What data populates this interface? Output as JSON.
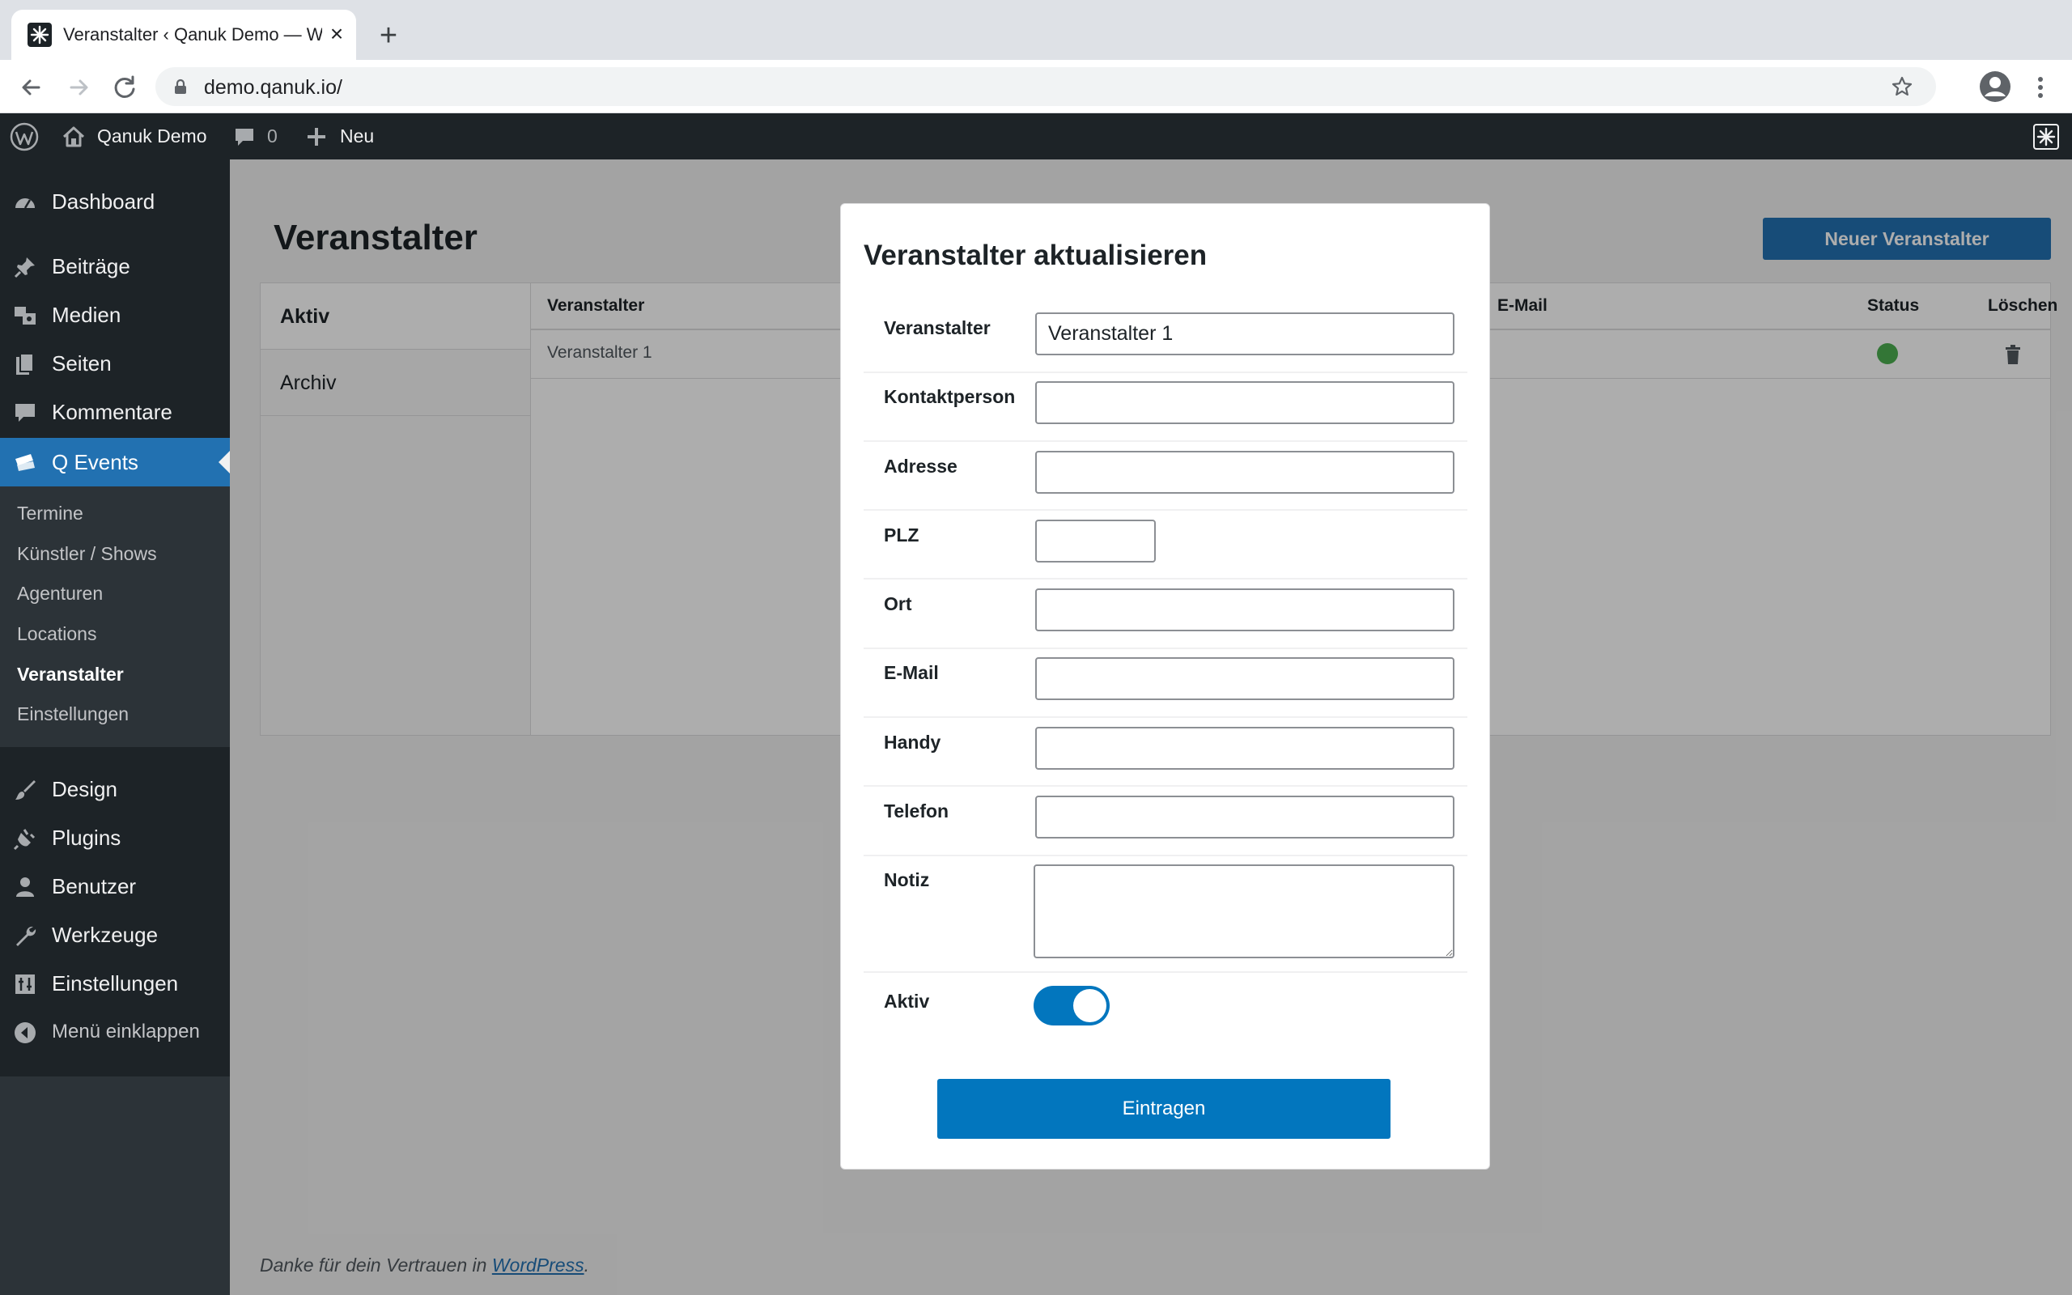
{
  "browser": {
    "tab_title": "Veranstalter ‹ Qanuk Demo — WordPress",
    "url": "demo.qanuk.io/",
    "icons": [
      "back-icon",
      "forward-icon",
      "reload-icon",
      "lock-icon",
      "star-icon",
      "profile-icon",
      "menu-icon"
    ]
  },
  "adminbar": {
    "site_name": "Qanuk Demo",
    "comments_count": "0",
    "new_label": "Neu"
  },
  "sidebar": {
    "items": [
      {
        "label": "Dashboard",
        "icon": "dashboard-icon"
      },
      {
        "label": "Beiträge",
        "icon": "pin-icon"
      },
      {
        "label": "Medien",
        "icon": "media-icon"
      },
      {
        "label": "Seiten",
        "icon": "pages-icon"
      },
      {
        "label": "Kommentare",
        "icon": "comment-icon"
      },
      {
        "label": "Q Events",
        "icon": "tickets-icon"
      }
    ],
    "submenu": [
      "Termine",
      "Künstler / Shows",
      "Agenturen",
      "Locations",
      "Veranstalter",
      "Einstellungen"
    ],
    "items_bottom": [
      {
        "label": "Design",
        "icon": "brush-icon"
      },
      {
        "label": "Plugins",
        "icon": "plugin-icon"
      },
      {
        "label": "Benutzer",
        "icon": "user-icon"
      },
      {
        "label": "Werkzeuge",
        "icon": "wrench-icon"
      },
      {
        "label": "Einstellungen",
        "icon": "settings-icon"
      }
    ],
    "collapse_label": "Menü einklappen"
  },
  "main": {
    "page_title": "Veranstalter",
    "new_button": "Neuer Veranstalter",
    "tabs": [
      "Aktiv",
      "Archiv"
    ],
    "columns": [
      "Veranstalter",
      "E-Mail",
      "Status",
      "Löschen"
    ],
    "rows": [
      {
        "name": "Veranstalter 1",
        "email": "",
        "status": "active"
      }
    ],
    "footer_prefix": "Danke für dein Vertrauen in ",
    "footer_link": "WordPress",
    "footer_suffix": "."
  },
  "modal": {
    "title": "Veranstalter aktualisieren",
    "fields": [
      {
        "label": "Veranstalter",
        "value": "Veranstalter 1"
      },
      {
        "label": "Kontaktperson",
        "value": ""
      },
      {
        "label": "Adresse",
        "value": ""
      },
      {
        "label": "PLZ",
        "value": ""
      },
      {
        "label": "Ort",
        "value": ""
      },
      {
        "label": "E-Mail",
        "value": ""
      },
      {
        "label": "Handy",
        "value": ""
      },
      {
        "label": "Telefon",
        "value": ""
      }
    ],
    "notiz_label": "Notiz",
    "notiz_value": "",
    "aktiv_label": "Aktiv",
    "aktiv_on": true,
    "submit_label": "Eintragen"
  },
  "colors": {
    "wp_dark": "#1d2327",
    "wp_blue": "#2271b1",
    "primary_button": "#0276be",
    "status_green": "#4caf50"
  }
}
